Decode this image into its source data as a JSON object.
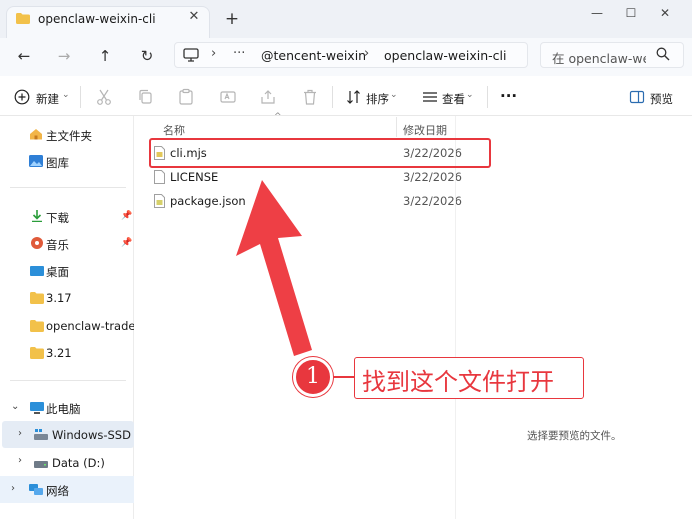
{
  "tab": {
    "title": "openclaw-weixin-cli",
    "close_glyph": "✕",
    "new_glyph": "+"
  },
  "window": {
    "minimize": "—",
    "maximize": "☐",
    "close": "✕"
  },
  "nav": {
    "back": "←",
    "forward": "→",
    "up": "↑",
    "refresh": "↻"
  },
  "address": {
    "more": "···",
    "sep": "›",
    "crumbs": [
      "@tencent-weixin",
      "openclaw-weixin-cli"
    ]
  },
  "search": {
    "placeholder": "在 openclaw-weixin-cli 中搜索"
  },
  "toolbar": {
    "new_label": "新建",
    "sort_label": "排序",
    "view_label": "查看",
    "more_label": "···",
    "preview_label": "预览"
  },
  "sidebar": {
    "home": "主文件夹",
    "gallery": "图库",
    "pinned": [
      "下载",
      "音乐",
      "桌面",
      "3.17",
      "openclaw-trade-e",
      "3.21"
    ],
    "this_pc": "此电脑",
    "drives": [
      "Windows-SSD (C",
      "Data (D:)"
    ],
    "network": "网络"
  },
  "columns": {
    "name": "名称",
    "modified": "修改日期"
  },
  "files": [
    {
      "name": "cli.mjs",
      "date": "3/22/2026"
    },
    {
      "name": "LICENSE",
      "date": "3/22/2026"
    },
    {
      "name": "package.json",
      "date": "3/22/2026"
    }
  ],
  "preview_hint": "选择要预览的文件。",
  "annotation": {
    "step": "1",
    "text": "找到这个文件打开"
  },
  "colors": {
    "accent": "#e8373e",
    "folder": "#f2c14a",
    "selected": "#e5ecf5"
  }
}
